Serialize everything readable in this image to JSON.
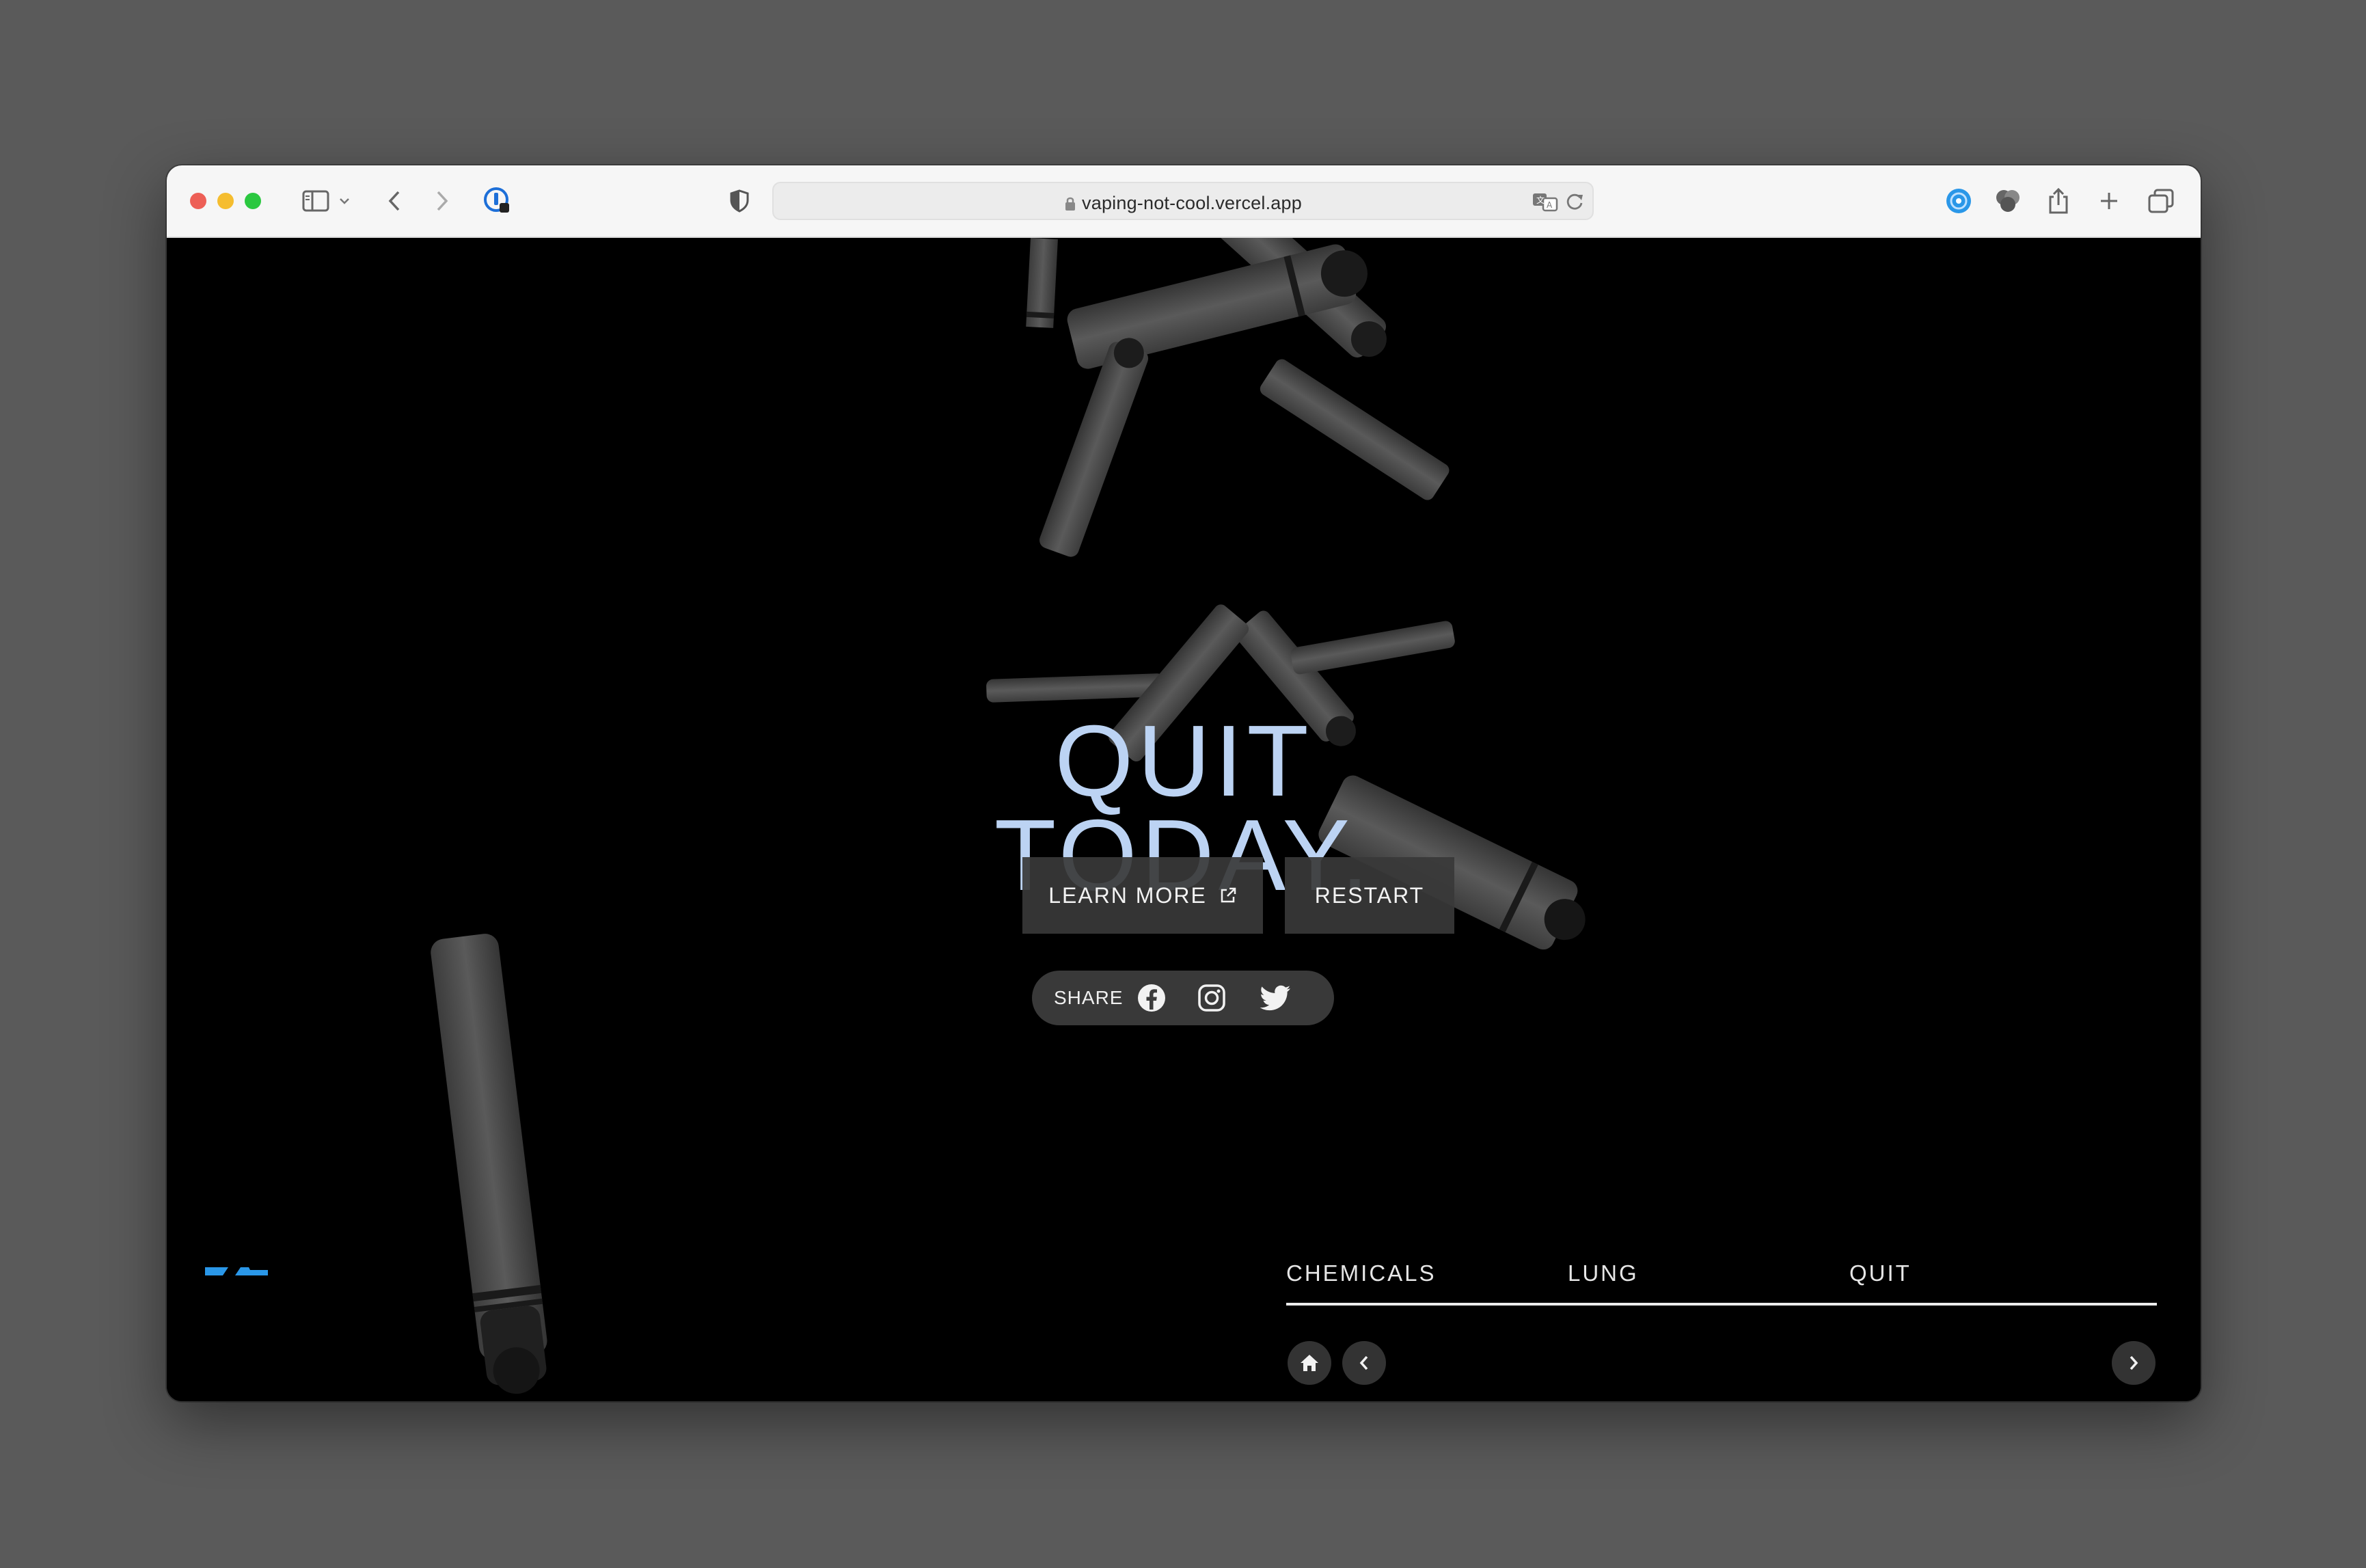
{
  "browser": {
    "url": "vaping-not-cool.vercel.app",
    "icons": [
      "sidebar-icon",
      "chevron-down-icon",
      "back-icon",
      "forward-icon",
      "extension-icon",
      "shield-icon",
      "lock-icon",
      "translate-icon",
      "reload-icon",
      "profile-icon",
      "extensions-icon",
      "share-icon",
      "new-tab-icon",
      "tab-overview-icon"
    ],
    "traffic_colors": {
      "close": "#ed5f56",
      "minimize": "#f5bd2f",
      "maximize": "#2bc840"
    }
  },
  "hero": {
    "title_line1": "QUIT",
    "title_line2": "TODAY.",
    "title_color": "#bcd3f3"
  },
  "buttons": {
    "learn_more": "LEARN MORE",
    "restart": "RESTART"
  },
  "share": {
    "label": "SHARE",
    "icons": [
      "facebook-icon",
      "instagram-icon",
      "twitter-icon"
    ]
  },
  "nav": {
    "items": [
      {
        "label": "CHEMICALS"
      },
      {
        "label": "LUNG"
      },
      {
        "label": "QUIT"
      }
    ],
    "controls": [
      "home-icon",
      "chevron-left-icon",
      "chevron-right-icon"
    ]
  },
  "colors": {
    "accent_logo": "#2a97e8",
    "background": "#000000"
  }
}
